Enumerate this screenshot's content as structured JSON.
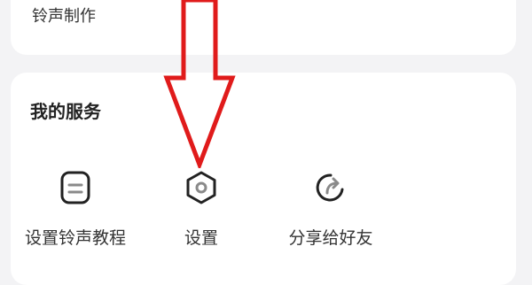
{
  "ringtone_card": {
    "label": "铃声制作"
  },
  "services": {
    "title": "我的服务",
    "items": [
      {
        "label": "设置铃声教程",
        "icon": "tutorial-doc-icon"
      },
      {
        "label": "设置",
        "icon": "hexagon-settings-icon"
      },
      {
        "label": "分享给好友",
        "icon": "share-arrow-icon"
      }
    ]
  },
  "annotation": {
    "type": "down-arrow",
    "color": "#e11"
  }
}
